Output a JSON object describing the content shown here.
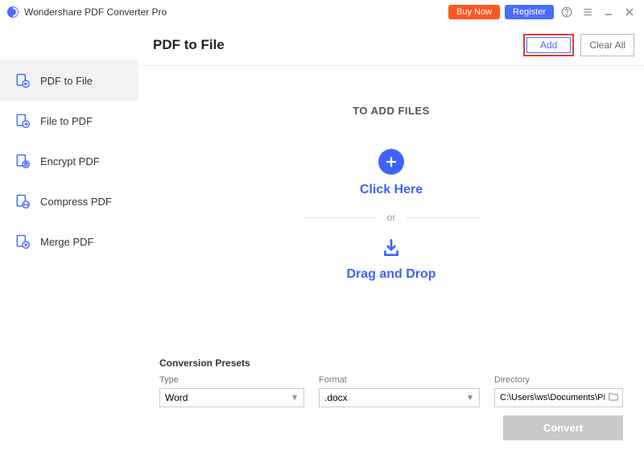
{
  "titlebar": {
    "app_name": "Wondershare PDF Converter Pro",
    "buy_now": "Buy Now",
    "register": "Register"
  },
  "sidebar": {
    "items": [
      {
        "label": "PDF to File"
      },
      {
        "label": "File to PDF"
      },
      {
        "label": "Encrypt PDF"
      },
      {
        "label": "Compress PDF"
      },
      {
        "label": "Merge PDF"
      }
    ]
  },
  "header": {
    "title": "PDF to File",
    "add": "Add",
    "clear_all": "Clear All"
  },
  "content": {
    "to_add": "TO ADD FILES",
    "click_here": "Click Here",
    "or": "or",
    "drag_drop": "Drag and Drop"
  },
  "presets": {
    "title": "Conversion Presets",
    "type_label": "Type",
    "type_value": "Word",
    "format_label": "Format",
    "format_value": ".docx",
    "directory_label": "Directory",
    "directory_value": "C:\\Users\\ws\\Documents\\PDFConvert",
    "convert": "Convert"
  }
}
